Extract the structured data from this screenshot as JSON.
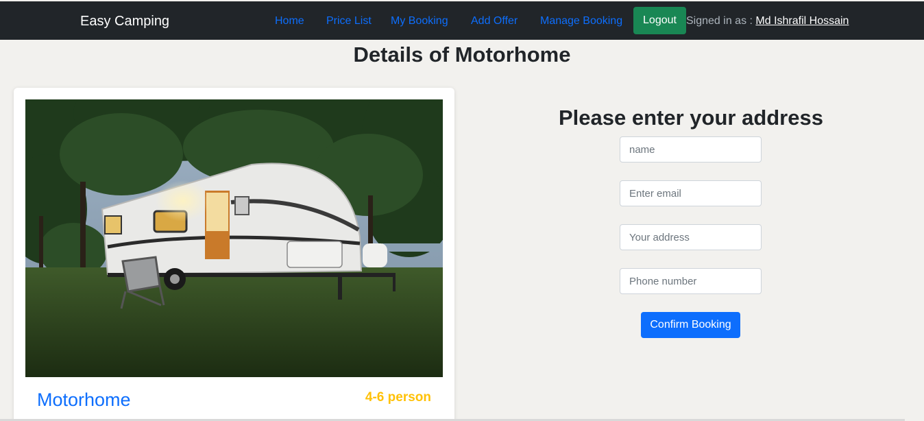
{
  "navbar": {
    "brand": "Easy Camping",
    "links": [
      {
        "label": "Home"
      },
      {
        "label": "Price List"
      },
      {
        "label": "My Booking"
      },
      {
        "label": "Add Offer"
      },
      {
        "label": "Manage Booking"
      }
    ],
    "logout_label": "Logout",
    "signed_in_prefix": "Signed in as : ",
    "signed_in_user": "Md Ishrafil Hossain"
  },
  "page": {
    "title": "Details of Motorhome"
  },
  "card": {
    "title": "Motorhome",
    "capacity": "4-6 person"
  },
  "form": {
    "title": "Please enter your address",
    "name_placeholder": "name",
    "email_placeholder": "Enter email",
    "address_placeholder": "Your address",
    "phone_placeholder": "Phone number",
    "submit_label": "Confirm Booking"
  },
  "colors": {
    "navbar_bg": "#212529",
    "link": "#0d6efd",
    "logout": "#198754",
    "primary": "#0d6efd",
    "capacity": "#ffc107",
    "page_bg": "#f2f1ee"
  }
}
